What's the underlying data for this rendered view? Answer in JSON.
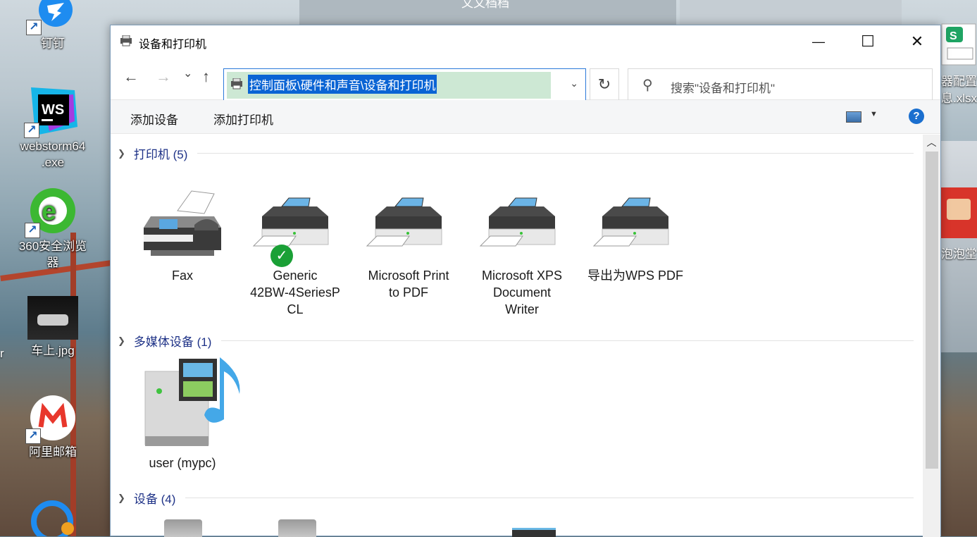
{
  "desktop": {
    "top_window_title": "文文档档",
    "icons": [
      {
        "label": "钉钉",
        "icon": "dingtalk-icon"
      },
      {
        "label": "webstorm64\n.exe",
        "icon": "webstorm-icon"
      },
      {
        "label": "360安全浏览\n器",
        "icon": "browser-360-icon"
      },
      {
        "label": "车上.jpg",
        "icon": "image-file-icon"
      },
      {
        "label": "阿里邮箱",
        "icon": "alimail-icon"
      }
    ],
    "right_icons": [
      {
        "label": "器配置\n息.xlsx",
        "icon": "excel-file-icon"
      },
      {
        "label": "泡泡堂",
        "icon": "game-icon"
      }
    ],
    "left_edge_text": "r"
  },
  "window": {
    "title": "设备和打印机",
    "minimize": "—",
    "maximize": "☐",
    "close": "✕",
    "nav": {
      "back": "←",
      "forward": "→",
      "recent": "⌄",
      "up": "↑"
    },
    "address": "控制面板\\硬件和声音\\设备和打印机",
    "address_dropdown": "⌄",
    "refresh": "↻",
    "search_placeholder": "搜索\"设备和打印机\"",
    "commands": [
      "添加设备",
      "添加打印机"
    ],
    "help": "?",
    "groups": [
      {
        "name": "打印机 (5)"
      },
      {
        "name": "多媒体设备 (1)"
      },
      {
        "name": "设备 (4)"
      }
    ],
    "printers": [
      {
        "label": "Fax",
        "icon": "fax-icon"
      },
      {
        "label": "Generic\n42BW-4SeriesP\nCL",
        "icon": "printer-icon",
        "default": true
      },
      {
        "label": "Microsoft Print\nto PDF",
        "icon": "printer-icon"
      },
      {
        "label": "Microsoft XPS\nDocument\nWriter",
        "icon": "printer-icon"
      },
      {
        "label": "导出为WPS PDF",
        "icon": "printer-icon"
      }
    ],
    "media": [
      {
        "label": "user (mypc)",
        "icon": "media-server-icon"
      }
    ],
    "colors": {
      "accent": "#0a64d4",
      "group_text": "#1e3287",
      "default_check": "#1aa036"
    }
  }
}
